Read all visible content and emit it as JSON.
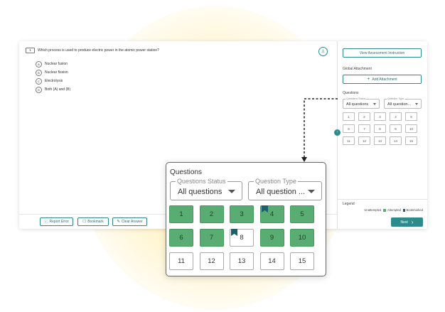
{
  "question": {
    "number": "1",
    "text": "Which process is used to produce electric power in the atomic power station?",
    "hint_icon": "person-hint-icon",
    "options": [
      {
        "letter": "A",
        "text": "Nuclear fusion"
      },
      {
        "letter": "B",
        "text": "Nuclear fission"
      },
      {
        "letter": "C",
        "text": "Electrolysis"
      },
      {
        "letter": "D",
        "text": "Both (A) and (B)"
      }
    ]
  },
  "footer": {
    "report_error": "Report Error",
    "bookmark": "Bookmark",
    "clear_answer": "Clear Answer",
    "next": "Next"
  },
  "sidebar": {
    "view_instruction": "View Assessment Instruction",
    "global_attachment_label": "Global Attachment",
    "add_attachment": "Add Attachment",
    "questions_label": "Questions",
    "status_legend": "Questions Status",
    "status_value": "All questions",
    "type_legend": "Question Type",
    "type_value": "All question...",
    "cells": [
      "1",
      "2",
      "3",
      "4",
      "5",
      "6",
      "7",
      "8",
      "9",
      "10",
      "11",
      "12",
      "13",
      "14",
      "15"
    ],
    "legend_title": "Legend",
    "legend_unattempted": "Unattempted",
    "legend_attempted": "Attempted",
    "legend_bookmarked": "Bookmarked"
  },
  "popup": {
    "title": "Questions",
    "status_legend": "Questions Status",
    "status_value": "All questions",
    "type_legend": "Question Type",
    "type_value": "All question ...",
    "cells": [
      {
        "label": "1",
        "state": "attempted",
        "bookmarked": false
      },
      {
        "label": "2",
        "state": "attempted",
        "bookmarked": false
      },
      {
        "label": "3",
        "state": "attempted",
        "bookmarked": false
      },
      {
        "label": "4",
        "state": "attempted",
        "bookmarked": true
      },
      {
        "label": "5",
        "state": "attempted",
        "bookmarked": false
      },
      {
        "label": "6",
        "state": "attempted",
        "bookmarked": false
      },
      {
        "label": "7",
        "state": "attempted",
        "bookmarked": false
      },
      {
        "label": "8",
        "state": "unattempted",
        "bookmarked": true
      },
      {
        "label": "9",
        "state": "attempted",
        "bookmarked": false
      },
      {
        "label": "10",
        "state": "attempted",
        "bookmarked": false
      },
      {
        "label": "11",
        "state": "unattempted",
        "bookmarked": false
      },
      {
        "label": "12",
        "state": "unattempted",
        "bookmarked": false
      },
      {
        "label": "13",
        "state": "unattempted",
        "bookmarked": false
      },
      {
        "label": "14",
        "state": "unattempted",
        "bookmarked": false
      },
      {
        "label": "15",
        "state": "unattempted",
        "bookmarked": false
      }
    ]
  },
  "colors": {
    "accent": "#2e8b8b",
    "attempted": "#5aad72",
    "bookmark": "#1f5f6b",
    "glow": "#ffe9a0"
  }
}
